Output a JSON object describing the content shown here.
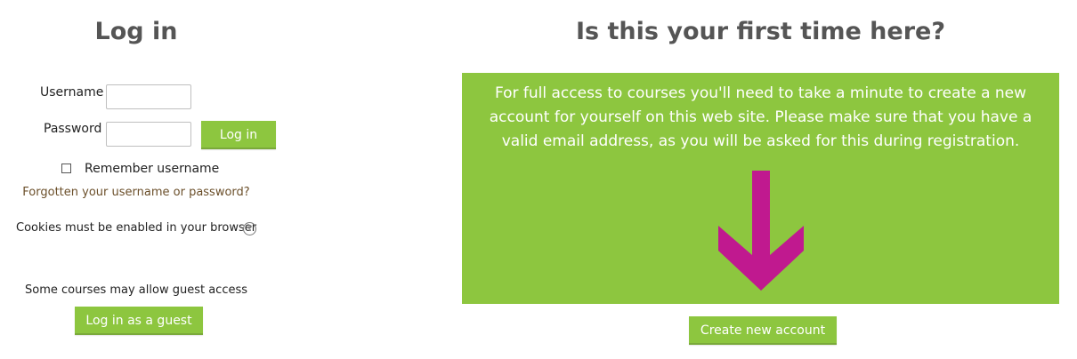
{
  "login": {
    "title": "Log in",
    "username_label": "Username",
    "username_value": "",
    "password_label": "Password",
    "password_value": "",
    "login_button": "Log in",
    "remember_label": "Remember username",
    "remember_checked": false,
    "forgot_link": "Forgotten your username or password?",
    "cookies_text": "Cookies must be enabled in your browser",
    "help_icon_glyph": "?",
    "guest_text": "Some courses may allow guest access",
    "guest_button": "Log in as a guest"
  },
  "signup": {
    "title": "Is this your first time here?",
    "description": "For full access to courses you'll need to take a minute to create a new account for yourself on this web site. Please make sure that you have a valid email address, as you will be asked for this during registration.",
    "create_button": "Create new account"
  },
  "colors": {
    "accent_green": "#8dc63f",
    "arrow_magenta": "#c0198f",
    "heading_gray": "#555555"
  },
  "icons": {
    "help": "question-circle-icon",
    "arrow": "arrow-down-icon"
  }
}
